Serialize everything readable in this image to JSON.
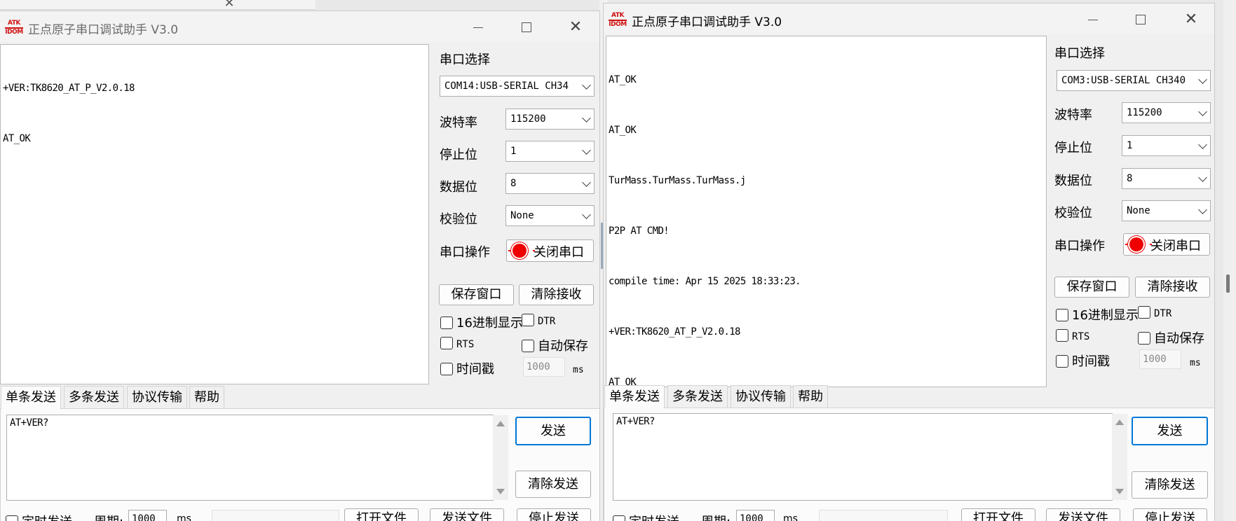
{
  "background": {
    "close_glyph": "✕"
  },
  "windows": [
    {
      "id": "left",
      "title": "正点原子串口调试助手 V3.0",
      "logo_top": "ATK",
      "logo_bottom": "IDOM",
      "receive_lines": [
        "+VER:TK8620_AT_P_V2.0.18",
        "AT_OK"
      ],
      "config": {
        "port_label": "串口选择",
        "port_value": "COM14:USB-SERIAL CH34",
        "baud_label": "波特率",
        "baud_value": "115200",
        "stop_label": "停止位",
        "stop_value": "1",
        "data_label": "数据位",
        "data_value": "8",
        "parity_label": "校验位",
        "parity_value": "None",
        "op_label": "串口操作",
        "op_button": "关闭串口"
      },
      "save_button": "保存窗口",
      "clear_recv_button": "清除接收",
      "options": {
        "hex_display": "16进制显示",
        "dtr": "DTR",
        "rts": "RTS",
        "auto_save": "自动保存",
        "timestamp": "时间戳",
        "timestamp_value": "1000",
        "ms": "ms"
      },
      "tabs": [
        "单条发送",
        "多条发送",
        "协议传输",
        "帮助"
      ],
      "send_text": "AT+VER?",
      "send_button": "发送",
      "clear_send_button": "清除发送",
      "bottom": {
        "timed_send": "定时发送",
        "period_label": "周期:",
        "period_value": "1000",
        "ms": "ms",
        "open_file": "打开文件",
        "send_file": "发送文件",
        "stop_send": "停止发送"
      }
    },
    {
      "id": "right",
      "title": "正点原子串口调试助手 V3.0",
      "logo_top": "ATK",
      "logo_bottom": "IDOM",
      "receive_lines": [
        "AT_OK",
        "AT_OK",
        "TurMass.TurMass.TurMass.j",
        "P2P AT CMD!",
        "compile time: Apr 15 2025 18:33:23.",
        "+VER:TK8620_AT_P_V2.0.18",
        "AT_OK"
      ],
      "config": {
        "port_label": "串口选择",
        "port_value": "COM3:USB-SERIAL CH340",
        "baud_label": "波特率",
        "baud_value": "115200",
        "stop_label": "停止位",
        "stop_value": "1",
        "data_label": "数据位",
        "data_value": "8",
        "parity_label": "校验位",
        "parity_value": "None",
        "op_label": "串口操作",
        "op_button": "关闭串口"
      },
      "save_button": "保存窗口",
      "clear_recv_button": "清除接收",
      "options": {
        "hex_display": "16进制显示",
        "dtr": "DTR",
        "rts": "RTS",
        "auto_save": "自动保存",
        "timestamp": "时间戳",
        "timestamp_value": "1000",
        "ms": "ms"
      },
      "tabs": [
        "单条发送",
        "多条发送",
        "协议传输",
        "帮助"
      ],
      "send_text": "AT+VER?",
      "send_button": "发送",
      "clear_send_button": "清除发送",
      "bottom": {
        "timed_send": "定时发送",
        "period_label": "周期:",
        "period_value": "1000",
        "ms": "ms",
        "open_file": "打开文件",
        "send_file": "发送文件",
        "stop_send": "停止发送"
      }
    }
  ],
  "colors": {
    "close_port_red": "#e00000",
    "focus_blue": "#0078d7",
    "logo_red": "#d01010"
  }
}
